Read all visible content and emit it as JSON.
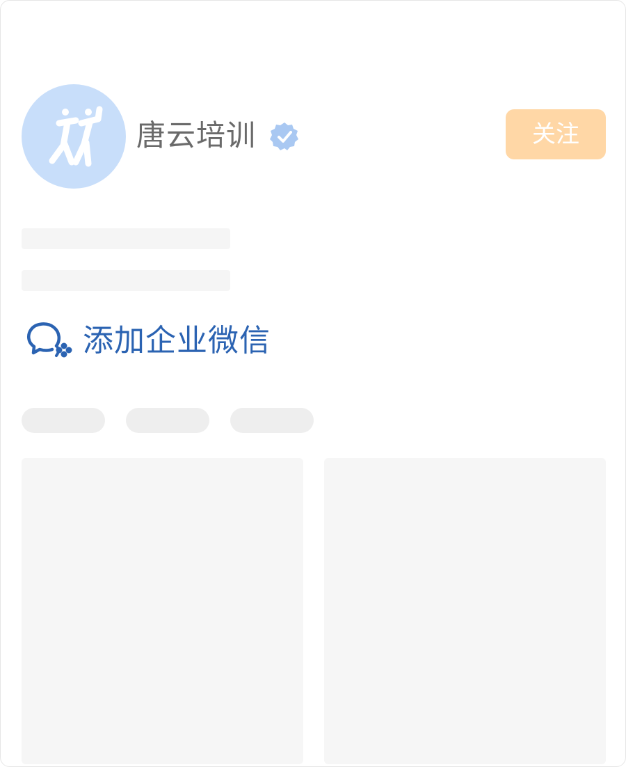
{
  "profile": {
    "name": "唐云培训",
    "avatar_icon": "logo-figures-icon",
    "avatar_color": "#c8defa",
    "verified_icon": "verified-badge-icon",
    "verified_color": "#a9c8f2"
  },
  "actions": {
    "follow_label": "关注",
    "follow_color": "#ffd7a6"
  },
  "wecom": {
    "label": "添加企业微信",
    "icon": "wecom-chat-icon",
    "color": "#2b63b2"
  }
}
